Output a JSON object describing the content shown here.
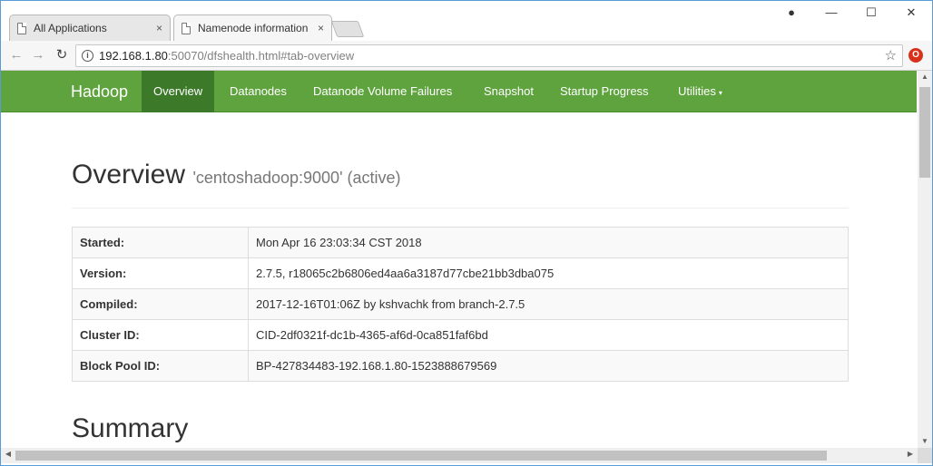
{
  "browser": {
    "tabs": [
      {
        "title": "All Applications",
        "close": "×"
      },
      {
        "title": "Namenode information",
        "close": "×"
      }
    ],
    "window_controls": {
      "profile": "●",
      "minimize": "—",
      "maximize": "☐",
      "close": "✕"
    },
    "nav": {
      "back": "←",
      "forward": "→",
      "reload": "↻"
    },
    "url": {
      "host": "192.168.1.80",
      "rest": ":50070/dfshealth.html#tab-overview"
    },
    "info_glyph": "i",
    "star": "☆",
    "extension_badge": "O"
  },
  "navbar": {
    "brand": "Hadoop",
    "items": [
      {
        "label": "Overview"
      },
      {
        "label": "Datanodes"
      },
      {
        "label": "Datanode Volume Failures"
      },
      {
        "label": "Snapshot"
      },
      {
        "label": "Startup Progress"
      },
      {
        "label": "Utilities"
      }
    ],
    "caret": "▾",
    "colors": {
      "bar": "#5fa33e",
      "active": "#3c7a29"
    }
  },
  "overview": {
    "title": "Overview",
    "subtitle": "'centoshadoop:9000' (active)",
    "rows": [
      {
        "key": "Started:",
        "value": "Mon Apr 16 23:03:34 CST 2018"
      },
      {
        "key": "Version:",
        "value": "2.7.5, r18065c2b6806ed4aa6a3187d77cbe21bb3dba075"
      },
      {
        "key": "Compiled:",
        "value": "2017-12-16T01:06Z by kshvachk from branch-2.7.5"
      },
      {
        "key": "Cluster ID:",
        "value": "CID-2df0321f-dc1b-4365-af6d-0ca851faf6bd"
      },
      {
        "key": "Block Pool ID:",
        "value": "BP-427834483-192.168.1.80-1523888679569"
      }
    ]
  },
  "summary": {
    "title": "Summary"
  },
  "scrollbars": {
    "up": "▲",
    "down": "▼",
    "left": "◀",
    "right": "▶"
  }
}
